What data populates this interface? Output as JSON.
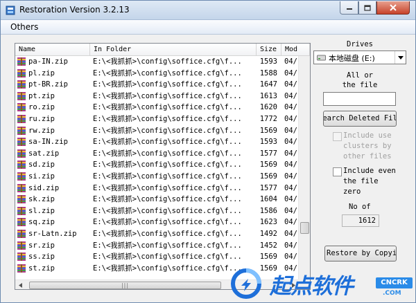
{
  "window": {
    "title": "Restoration Version 3.2.13"
  },
  "menu": {
    "items": [
      "Others"
    ]
  },
  "columns": [
    "Name",
    "In Folder",
    "Size",
    "Mod"
  ],
  "files": [
    {
      "name": "pa-IN.zip",
      "folder": "E:\\<我抓抓>\\config\\soffice.cfg\\f...",
      "size": "1593",
      "mod": "04/"
    },
    {
      "name": "pl.zip",
      "folder": "E:\\<我抓抓>\\config\\soffice.cfg\\f...",
      "size": "1588",
      "mod": "04/"
    },
    {
      "name": "pt-BR.zip",
      "folder": "E:\\<我抓抓>\\config\\soffice.cfg\\f...",
      "size": "1647",
      "mod": "04/"
    },
    {
      "name": "pt.zip",
      "folder": "E:\\<我抓抓>\\config\\soffice.cfg\\f...",
      "size": "1613",
      "mod": "04/"
    },
    {
      "name": "ro.zip",
      "folder": "E:\\<我抓抓>\\config\\soffice.cfg\\f...",
      "size": "1620",
      "mod": "04/"
    },
    {
      "name": "ru.zip",
      "folder": "E:\\<我抓抓>\\config\\soffice.cfg\\f...",
      "size": "1772",
      "mod": "04/"
    },
    {
      "name": "rw.zip",
      "folder": "E:\\<我抓抓>\\config\\soffice.cfg\\f...",
      "size": "1569",
      "mod": "04/"
    },
    {
      "name": "sa-IN.zip",
      "folder": "E:\\<我抓抓>\\config\\soffice.cfg\\f...",
      "size": "1593",
      "mod": "04/"
    },
    {
      "name": "sat.zip",
      "folder": "E:\\<我抓抓>\\config\\soffice.cfg\\f...",
      "size": "1577",
      "mod": "04/"
    },
    {
      "name": "sd.zip",
      "folder": "E:\\<我抓抓>\\config\\soffice.cfg\\f...",
      "size": "1569",
      "mod": "04/"
    },
    {
      "name": "si.zip",
      "folder": "E:\\<我抓抓>\\config\\soffice.cfg\\f...",
      "size": "1569",
      "mod": "04/"
    },
    {
      "name": "sid.zip",
      "folder": "E:\\<我抓抓>\\config\\soffice.cfg\\f...",
      "size": "1577",
      "mod": "04/"
    },
    {
      "name": "sk.zip",
      "folder": "E:\\<我抓抓>\\config\\soffice.cfg\\f...",
      "size": "1604",
      "mod": "04/"
    },
    {
      "name": "sl.zip",
      "folder": "E:\\<我抓抓>\\config\\soffice.cfg\\f...",
      "size": "1586",
      "mod": "04/"
    },
    {
      "name": "sq.zip",
      "folder": "E:\\<我抓抓>\\config\\soffice.cfg\\f...",
      "size": "1623",
      "mod": "04/"
    },
    {
      "name": "sr-Latn.zip",
      "folder": "E:\\<我抓抓>\\config\\soffice.cfg\\f...",
      "size": "1492",
      "mod": "04/"
    },
    {
      "name": "sr.zip",
      "folder": "E:\\<我抓抓>\\config\\soffice.cfg\\f...",
      "size": "1452",
      "mod": "04/"
    },
    {
      "name": "ss.zip",
      "folder": "E:\\<我抓抓>\\config\\soffice.cfg\\f...",
      "size": "1569",
      "mod": "04/"
    },
    {
      "name": "st.zip",
      "folder": "E:\\<我抓抓>\\config\\soffice.cfg\\f...",
      "size": "1569",
      "mod": "04/"
    }
  ],
  "panel": {
    "drives_label": "Drives",
    "drive_selected": "本地磁盘 (E:)",
    "file_hint_line1": "All or",
    "file_hint_line2": "the file",
    "search_button": "Search Deleted Files",
    "include_clusters_line1": "Include use",
    "include_clusters_line2": "clusters by",
    "include_clusters_line3": "other files",
    "include_zero_line1": "Include even",
    "include_zero_line2": "the file",
    "include_zero_line3": "zero",
    "count_label": "No of",
    "count_value": "1612",
    "restore_button": "Restore by Copying"
  },
  "watermark": {
    "text": "起点软件",
    "badge": "CNCRK",
    "domain": ".COM"
  },
  "colors": {
    "accent": "#1e6fd9",
    "titlebar": "#c4d5ea",
    "close": "#c7432b"
  },
  "icons": {
    "app": "restoration-app-icon",
    "file": "zip-archive-icon",
    "drive": "hard-drive-icon"
  }
}
